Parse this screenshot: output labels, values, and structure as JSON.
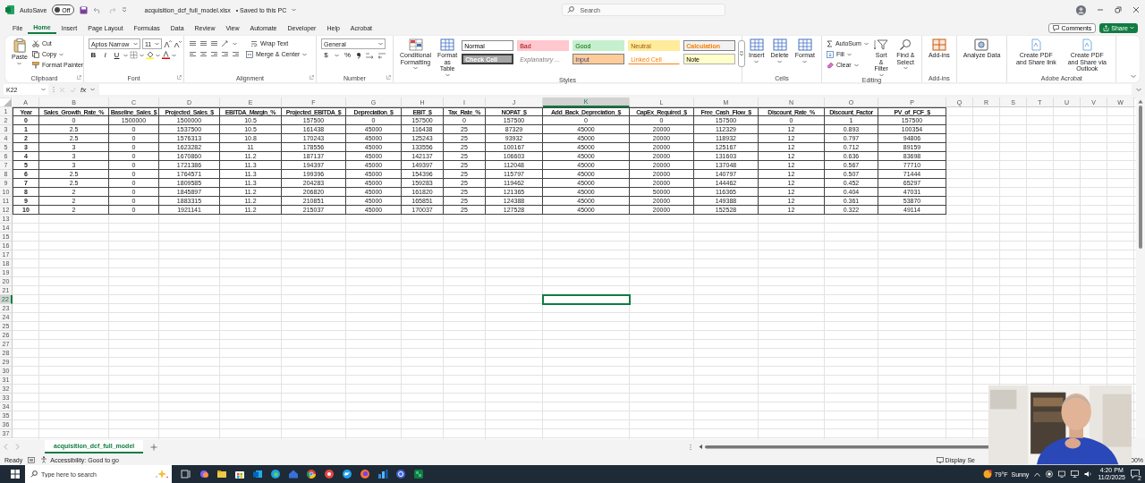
{
  "title_bar": {
    "autosave_label": "AutoSave",
    "autosave_state": "Off",
    "autosave_on": false,
    "filename": "acquisition_dcf_full_model.xlsx",
    "save_status": "• Saved to this PC",
    "search_placeholder": "Search"
  },
  "menu_tabs": [
    {
      "label": "File",
      "selected": false
    },
    {
      "label": "Home",
      "selected": true
    },
    {
      "label": "Insert",
      "selected": false
    },
    {
      "label": "Page Layout",
      "selected": false
    },
    {
      "label": "Formulas",
      "selected": false
    },
    {
      "label": "Data",
      "selected": false
    },
    {
      "label": "Review",
      "selected": false
    },
    {
      "label": "View",
      "selected": false
    },
    {
      "label": "Automate",
      "selected": false
    },
    {
      "label": "Developer",
      "selected": false
    },
    {
      "label": "Help",
      "selected": false
    },
    {
      "label": "Acrobat",
      "selected": false
    }
  ],
  "comments_button": "Comments",
  "share_button": "Share",
  "ribbon": [
    {
      "kind": "clipboard",
      "label": "Clipboard",
      "paste": "Paste",
      "cut": "Cut",
      "copy": "Copy",
      "format_painter": "Format Painter"
    },
    {
      "kind": "font",
      "label": "Font",
      "font_name": "Aptos Narrow",
      "font_size": "11",
      "bold": "B",
      "italic": "I",
      "underline": "U"
    },
    {
      "kind": "alignment",
      "label": "Alignment",
      "wrap": "Wrap Text",
      "merge": "Merge & Center"
    },
    {
      "kind": "number",
      "label": "Number",
      "format": "General",
      "currency": "$",
      "percent": "%"
    },
    {
      "kind": "styles",
      "label": "Styles",
      "conditional": "Conditional Formatting",
      "table": "Format as Table",
      "cell_styles": [
        {
          "label": "Normal",
          "kind": "normal"
        },
        {
          "label": "Bad",
          "kind": "bad"
        },
        {
          "label": "Good",
          "kind": "good"
        },
        {
          "label": "Neutral",
          "kind": "neutral"
        },
        {
          "label": "Calculation",
          "kind": "calculation"
        },
        {
          "label": "Check Cell",
          "kind": "check"
        },
        {
          "label": "Explanatory ...",
          "kind": "explanatory"
        },
        {
          "label": "Input",
          "kind": "input"
        },
        {
          "label": "Linked Cell",
          "kind": "linked"
        },
        {
          "label": "Note",
          "kind": "note"
        }
      ]
    },
    {
      "kind": "cells",
      "label": "Cells",
      "buttons": [
        "Insert",
        "Delete",
        "Format"
      ]
    },
    {
      "kind": "editing",
      "label": "Editing",
      "autosum": "AutoSum",
      "fill": "Fill",
      "clear": "Clear",
      "sort": "Sort & Filter",
      "find": "Find & Select"
    },
    {
      "kind": "addins",
      "label": "Add-ins",
      "buttons": [
        "Add-ins"
      ]
    },
    {
      "kind": "analyze",
      "buttons": [
        "Analyze Data"
      ]
    },
    {
      "kind": "acrobat",
      "label": "Adobe Acrobat",
      "buttons": [
        "Create PDF and Share link",
        "Create PDF and Share via Outlook"
      ]
    }
  ],
  "formula_bar": {
    "name_box": "K22",
    "function_label": "fx"
  },
  "sheet": {
    "columns": [
      {
        "letter": "A",
        "selected": false
      },
      {
        "letter": "B",
        "selected": false
      },
      {
        "letter": "C",
        "selected": false
      },
      {
        "letter": "D",
        "selected": false
      },
      {
        "letter": "E",
        "selected": false
      },
      {
        "letter": "F",
        "selected": false
      },
      {
        "letter": "G",
        "selected": false
      },
      {
        "letter": "H",
        "selected": false
      },
      {
        "letter": "I",
        "selected": false
      },
      {
        "letter": "J",
        "selected": false
      },
      {
        "letter": "K",
        "selected": true
      },
      {
        "letter": "L",
        "selected": false
      },
      {
        "letter": "M",
        "selected": false
      },
      {
        "letter": "N",
        "selected": false
      },
      {
        "letter": "O",
        "selected": false
      },
      {
        "letter": "P",
        "selected": false
      },
      {
        "letter": "Q",
        "selected": false
      },
      {
        "letter": "R",
        "selected": false
      },
      {
        "letter": "S",
        "selected": false
      },
      {
        "letter": "T",
        "selected": false
      },
      {
        "letter": "U",
        "selected": false
      },
      {
        "letter": "V",
        "selected": false
      },
      {
        "letter": "W",
        "selected": false
      }
    ],
    "rows": [
      {
        "label": "1",
        "selected": false
      },
      {
        "label": "2",
        "selected": false
      },
      {
        "label": "3",
        "selected": false
      },
      {
        "label": "4",
        "selected": false
      },
      {
        "label": "5",
        "selected": false
      },
      {
        "label": "6",
        "selected": false
      },
      {
        "label": "7",
        "selected": false
      },
      {
        "label": "8",
        "selected": false
      },
      {
        "label": "9",
        "selected": false
      },
      {
        "label": "10",
        "selected": false
      },
      {
        "label": "11",
        "selected": false
      },
      {
        "label": "12",
        "selected": false
      },
      {
        "label": "13",
        "selected": false
      },
      {
        "label": "14",
        "selected": false
      },
      {
        "label": "15",
        "selected": false
      },
      {
        "label": "16",
        "selected": false
      },
      {
        "label": "17",
        "selected": false
      },
      {
        "label": "18",
        "selected": false
      },
      {
        "label": "19",
        "selected": false
      },
      {
        "label": "20",
        "selected": false
      },
      {
        "label": "21",
        "selected": false
      },
      {
        "label": "22",
        "selected": true
      },
      {
        "label": "23",
        "selected": false
      },
      {
        "label": "24",
        "selected": false
      },
      {
        "label": "25",
        "selected": false
      },
      {
        "label": "26",
        "selected": false
      },
      {
        "label": "27",
        "selected": false
      },
      {
        "label": "28",
        "selected": false
      },
      {
        "label": "29",
        "selected": false
      },
      {
        "label": "30",
        "selected": false
      },
      {
        "label": "31",
        "selected": false
      },
      {
        "label": "32",
        "selected": false
      },
      {
        "label": "33",
        "selected": false
      },
      {
        "label": "34",
        "selected": false
      },
      {
        "label": "35",
        "selected": false
      },
      {
        "label": "36",
        "selected": false
      },
      {
        "label": "37",
        "selected": false
      }
    ],
    "cells": [
      [
        "Year",
        "Sales_Growth_Rate_%",
        "Baseline_Sales_$",
        "Projected_Sales_$",
        "EBITDA_Margin_%",
        "Projected_EBITDA_$",
        "Depreciation_$",
        "EBIT_$",
        "Tax_Rate_%",
        "NOPAT_$",
        "Add_Back_Depreciation_$",
        "CapEx_Required_$",
        "Free_Cash_Flow_$",
        "Discount_Rate_%",
        "Discount_Factor",
        "PV_of_FCF_$"
      ],
      [
        "0",
        "0",
        "1500000",
        "1500000",
        "10.5",
        "157500",
        "0",
        "157500",
        "0",
        "157500",
        "0",
        "0",
        "157500",
        "0",
        "1",
        "157500"
      ],
      [
        "1",
        "2.5",
        "0",
        "1537500",
        "10.5",
        "161438",
        "45000",
        "116438",
        "25",
        "87329",
        "45000",
        "20000",
        "112329",
        "12",
        "0.893",
        "100354"
      ],
      [
        "2",
        "2.5",
        "0",
        "1576313",
        "10.8",
        "170243",
        "45000",
        "125243",
        "25",
        "93932",
        "45000",
        "20000",
        "118932",
        "12",
        "0.797",
        "94806"
      ],
      [
        "3",
        "3",
        "0",
        "1623282",
        "11",
        "178556",
        "45000",
        "133556",
        "25",
        "100167",
        "45000",
        "20000",
        "125167",
        "12",
        "0.712",
        "89159"
      ],
      [
        "4",
        "3",
        "0",
        "1670860",
        "11.2",
        "187137",
        "45000",
        "142137",
        "25",
        "106603",
        "45000",
        "20000",
        "131603",
        "12",
        "0.636",
        "83698"
      ],
      [
        "5",
        "3",
        "0",
        "1721386",
        "11.3",
        "194397",
        "45000",
        "149397",
        "25",
        "112048",
        "45000",
        "20000",
        "137048",
        "12",
        "0.567",
        "77710"
      ],
      [
        "6",
        "2.5",
        "0",
        "1764571",
        "11.3",
        "199396",
        "45000",
        "154396",
        "25",
        "115797",
        "45000",
        "20000",
        "140797",
        "12",
        "0.507",
        "71444"
      ],
      [
        "7",
        "2.5",
        "0",
        "1809585",
        "11.3",
        "204283",
        "45000",
        "159283",
        "25",
        "119462",
        "45000",
        "20000",
        "144462",
        "12",
        "0.452",
        "65297"
      ],
      [
        "8",
        "2",
        "0",
        "1845897",
        "11.2",
        "206820",
        "45000",
        "161820",
        "25",
        "121365",
        "45000",
        "50000",
        "116365",
        "12",
        "0.404",
        "47031"
      ],
      [
        "9",
        "2",
        "0",
        "1883315",
        "11.2",
        "210851",
        "45000",
        "165851",
        "25",
        "124388",
        "45000",
        "20000",
        "149388",
        "12",
        "0.361",
        "53870"
      ],
      [
        "10",
        "2",
        "0",
        "1921141",
        "11.2",
        "215037",
        "45000",
        "170037",
        "25",
        "127528",
        "45000",
        "20000",
        "152528",
        "12",
        "0.322",
        "49114"
      ]
    ]
  },
  "sheet_tabs": [
    {
      "label": "acquisition_dcf_full_model",
      "selected": true
    }
  ],
  "status_bar": {
    "ready": "Ready",
    "accessibility": "Accessibility: Good to go",
    "display_settings": "Display Se",
    "zoom": "00%"
  },
  "taskbar": {
    "search_placeholder": "Type here to search",
    "weather": "79°F  Sunny",
    "time": "4:20 PM",
    "date": "11/2/2025",
    "notifications": "2"
  }
}
